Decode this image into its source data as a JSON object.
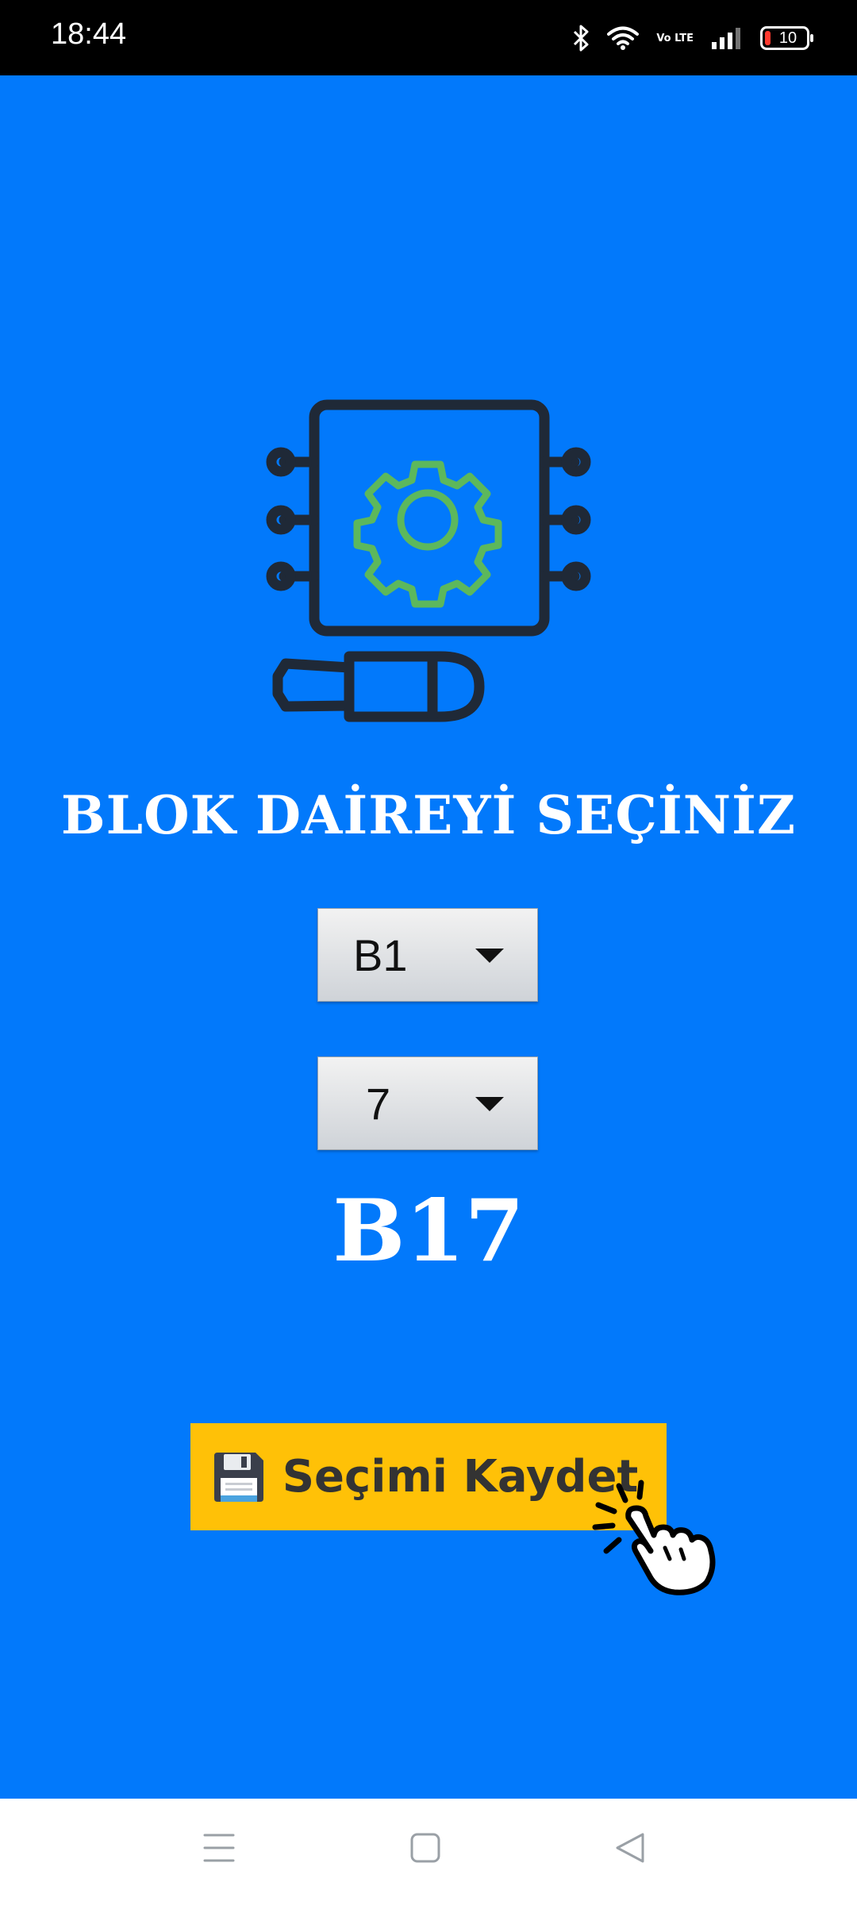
{
  "status_bar": {
    "time": "18:44",
    "network_label": "Vo LTE",
    "battery_level": "10",
    "icons": [
      "bluetooth-icon",
      "wifi-icon",
      "volte-icon",
      "signal-icon",
      "battery-icon"
    ]
  },
  "main": {
    "icon": "chip-gear-screwdriver-icon",
    "title": "BLOK DAİREYİ SEÇİNİZ",
    "block_select": {
      "value": "B1"
    },
    "flat_select": {
      "value": "7"
    },
    "result": "B17",
    "save_button": {
      "icon": "floppy-disk-icon",
      "label": "Seçimi Kaydet"
    },
    "tap_hint_icon": "tap-hand-icon"
  },
  "nav_bar": {
    "icons": [
      "menu-icon",
      "home-icon",
      "back-icon"
    ]
  },
  "colors": {
    "background": "#0279fb",
    "button": "#ffc107",
    "icon_outline": "#1f2937",
    "gear": "#5cb85c"
  }
}
